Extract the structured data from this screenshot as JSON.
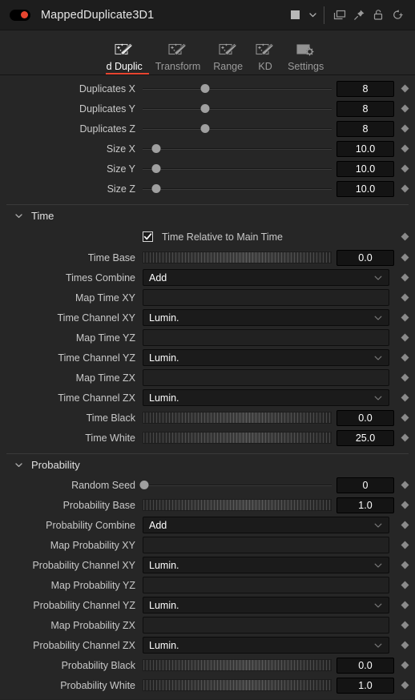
{
  "titlebar": {
    "node_name": "MappedDuplicate3D1",
    "toggle_state": "enabled",
    "accent_color": "#e8452f",
    "swatch_color": "#b9b9b9",
    "icons": [
      "color-swatch",
      "chevron-down-icon",
      "duplicate-window-icon",
      "pin-icon",
      "lock-open-icon",
      "reset-history-icon"
    ]
  },
  "tabs": [
    {
      "label": "oped Duplic",
      "icon": "magic-wand-icon",
      "active": true,
      "clipped": true
    },
    {
      "label": "Transform",
      "icon": "magic-wand-icon",
      "active": false,
      "clipped": false
    },
    {
      "label": "Range",
      "icon": "magic-wand-icon",
      "active": false,
      "clipped": false
    },
    {
      "label": "KD",
      "icon": "magic-wand-icon",
      "active": false,
      "clipped": false
    },
    {
      "label": "Settings",
      "icon": "gear-panel-icon",
      "active": false,
      "clipped": false
    }
  ],
  "top_controls": [
    {
      "label": "Duplicates X",
      "type": "slider",
      "value": "8",
      "thumb_pct": 33
    },
    {
      "label": "Duplicates Y",
      "type": "slider",
      "value": "8",
      "thumb_pct": 33
    },
    {
      "label": "Duplicates Z",
      "type": "slider",
      "value": "8",
      "thumb_pct": 33
    },
    {
      "label": "Size X",
      "type": "slider",
      "value": "10.0",
      "thumb_pct": 7
    },
    {
      "label": "Size Y",
      "type": "slider",
      "value": "10.0",
      "thumb_pct": 7
    },
    {
      "label": "Size Z",
      "type": "slider",
      "value": "10.0",
      "thumb_pct": 7
    }
  ],
  "time_section": {
    "title": "Time",
    "expanded": true,
    "checkbox": {
      "label": "Time Relative to Main Time",
      "checked": true
    },
    "rows": [
      {
        "label": "Time Base",
        "type": "scrub",
        "value": "0.0"
      },
      {
        "label": "Times Combine",
        "type": "dropdown",
        "value": "Add"
      },
      {
        "label": "Map Time XY",
        "type": "text",
        "value": ""
      },
      {
        "label": "Time Channel XY",
        "type": "dropdown",
        "value": "Lumin."
      },
      {
        "label": "Map Time YZ",
        "type": "text",
        "value": ""
      },
      {
        "label": "Time Channel YZ",
        "type": "dropdown",
        "value": "Lumin."
      },
      {
        "label": "Map Time ZX",
        "type": "text",
        "value": ""
      },
      {
        "label": "Time Channel ZX",
        "type": "dropdown",
        "value": "Lumin."
      },
      {
        "label": "Time Black",
        "type": "scrub",
        "value": "0.0"
      },
      {
        "label": "Time White",
        "type": "scrub",
        "value": "25.0"
      }
    ]
  },
  "probability_section": {
    "title": "Probability",
    "expanded": true,
    "rows": [
      {
        "label": "Random Seed",
        "type": "slider",
        "value": "0",
        "thumb_pct": 1
      },
      {
        "label": "Probability Base",
        "type": "scrub",
        "value": "1.0"
      },
      {
        "label": "Probability Combine",
        "type": "dropdown",
        "value": "Add"
      },
      {
        "label": "Map Probability XY",
        "type": "text",
        "value": ""
      },
      {
        "label": "Probability Channel XY",
        "type": "dropdown",
        "value": "Lumin."
      },
      {
        "label": "Map Probability YZ",
        "type": "text",
        "value": ""
      },
      {
        "label": "Probability Channel YZ",
        "type": "dropdown",
        "value": "Lumin."
      },
      {
        "label": "Map Probability ZX",
        "type": "text",
        "value": ""
      },
      {
        "label": "Probability Channel ZX",
        "type": "dropdown",
        "value": "Lumin."
      },
      {
        "label": "Probability Black",
        "type": "scrub",
        "value": "0.0"
      },
      {
        "label": "Probability White",
        "type": "scrub",
        "value": "1.0"
      }
    ]
  }
}
